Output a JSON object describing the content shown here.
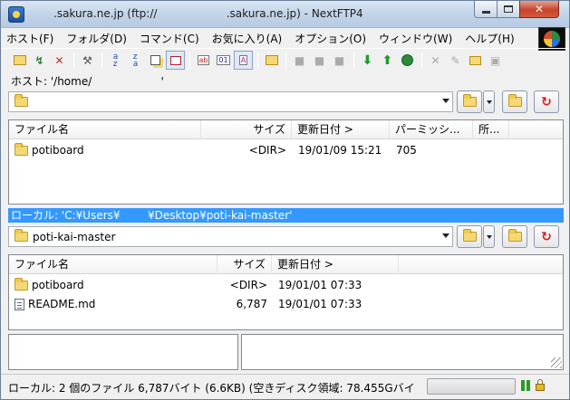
{
  "window": {
    "title": ".sakura.ne.jp (ftp://                    .sakura.ne.jp) - NextFTP4"
  },
  "menu": [
    "ホスト(F)",
    "フォルダ(D)",
    "コマンド(C)",
    "お気に入り(A)",
    "オプション(O)",
    "ウィンドウ(W)",
    "ヘルプ(H)"
  ],
  "host": {
    "path_label": "ホスト: '/home/                    '",
    "folder_value": "",
    "columns": [
      "ファイル名",
      "サイズ",
      "更新日付 >",
      "パーミッシ...",
      "所..."
    ],
    "rows": [
      {
        "name": "potiboard",
        "size": "<DIR>",
        "date": "19/01/09 15:21",
        "perm": "705",
        "icon": "folder-icon"
      }
    ]
  },
  "local": {
    "path_label": "ローカル: 'C:¥Users¥        ¥Desktop¥poti-kai-master'",
    "folder_value": "poti-kai-master",
    "columns": [
      "ファイル名",
      "サイズ",
      "更新日付 >"
    ],
    "rows": [
      {
        "name": "potiboard",
        "size": "<DIR>",
        "date": "19/01/01 07:33",
        "icon": "folder-icon"
      },
      {
        "name": "README.md",
        "size": "6,787",
        "date": "19/01/01 07:33",
        "icon": "file-icon"
      }
    ]
  },
  "status": {
    "text": "ローカル: 2 個のファイル  6,787バイト (6.6KB)  (空きディスク領域: 78.455Gバイ"
  },
  "icons": {
    "toolbar": [
      "connect-icon",
      "quick-connect-icon",
      "disconnect-icon",
      "settings-icon",
      "sort-name-icon",
      "sort-name-desc-icon",
      "copy-icon",
      "view-toggle-icon",
      "ascii-icon",
      "binary-icon",
      "auto-mode-icon",
      "folder-icon",
      "toolbar-disabled-1-icon",
      "toolbar-disabled-2-icon",
      "toolbar-disabled-3-icon",
      "download-icon",
      "upload-icon",
      "sync-icon",
      "delete-icon",
      "rename-icon",
      "new-folder-icon",
      "properties-icon"
    ]
  },
  "colors": {
    "selection": "#3399ff",
    "download": "#1f9d2b",
    "upload": "#1f9d2b"
  }
}
